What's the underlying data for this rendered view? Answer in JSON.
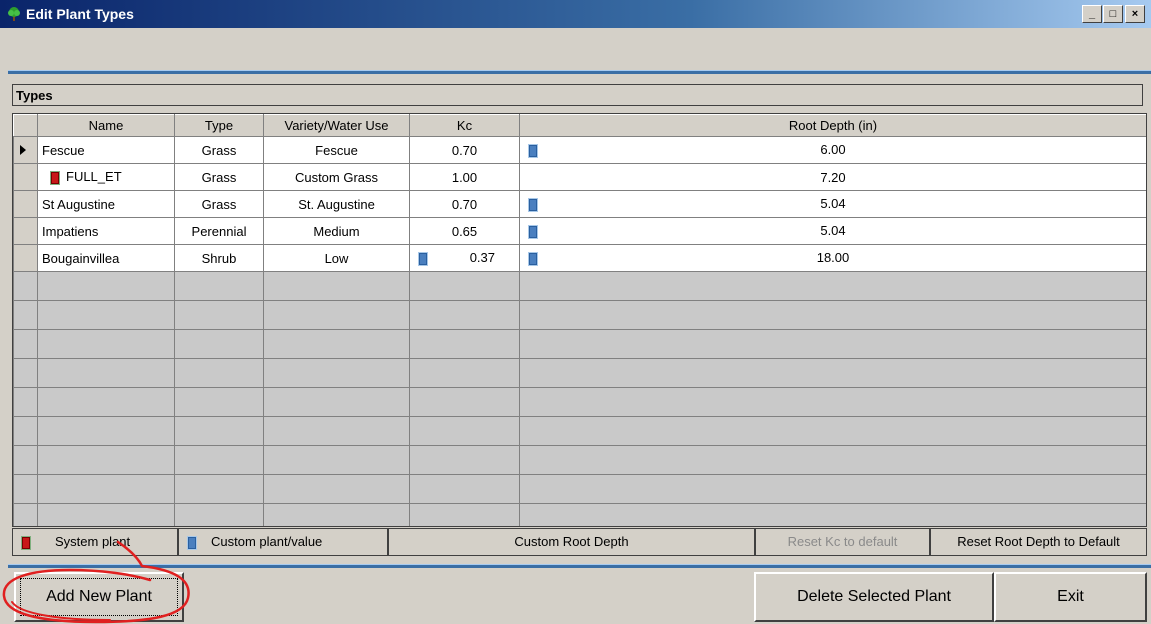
{
  "window": {
    "title": "Edit Plant Types",
    "icon": "tree-icon",
    "controls": {
      "minimize": "_",
      "maximize": "□",
      "close": "×"
    }
  },
  "section": {
    "title": "Types"
  },
  "grid": {
    "columns": [
      "Name",
      "Type",
      "Variety/Water Use",
      "Kc",
      "Root Depth (in)"
    ],
    "rows": [
      {
        "name": "Fescue",
        "type": "Grass",
        "variety": "Fescue",
        "kc": "0.70",
        "root_depth": "6.00",
        "selected": true,
        "name_marker": "none",
        "kc_marker": "none",
        "root_marker": "blue"
      },
      {
        "name": "FULL_ET",
        "type": "Grass",
        "variety": "Custom Grass",
        "kc": "1.00",
        "root_depth": "7.20",
        "selected": false,
        "name_marker": "red",
        "kc_marker": "none",
        "root_marker": "none"
      },
      {
        "name": "St Augustine",
        "type": "Grass",
        "variety": "St. Augustine",
        "kc": "0.70",
        "root_depth": "5.04",
        "selected": false,
        "name_marker": "none",
        "kc_marker": "none",
        "root_marker": "blue"
      },
      {
        "name": "Impatiens",
        "type": "Perennial",
        "variety": "Medium",
        "kc": "0.65",
        "root_depth": "5.04",
        "selected": false,
        "name_marker": "none",
        "kc_marker": "none",
        "root_marker": "blue"
      },
      {
        "name": "Bougainvillea",
        "type": "Shrub",
        "variety": "Low",
        "kc": "0.37",
        "root_depth": "18.00",
        "selected": false,
        "name_marker": "none",
        "kc_marker": "blue",
        "root_marker": "blue"
      }
    ]
  },
  "legend": {
    "system_plant": "System plant",
    "custom_plant": "Custom plant/value",
    "custom_root_depth": "Custom Root Depth",
    "reset_kc": "Reset Kc to default",
    "reset_root": "Reset Root Depth to Default"
  },
  "buttons": {
    "add": "Add New Plant",
    "delete": "Delete Selected Plant",
    "exit": "Exit"
  },
  "colors": {
    "system_marker": "#c81818",
    "custom_marker": "#4a7fbf",
    "annotation": "#e02020"
  }
}
